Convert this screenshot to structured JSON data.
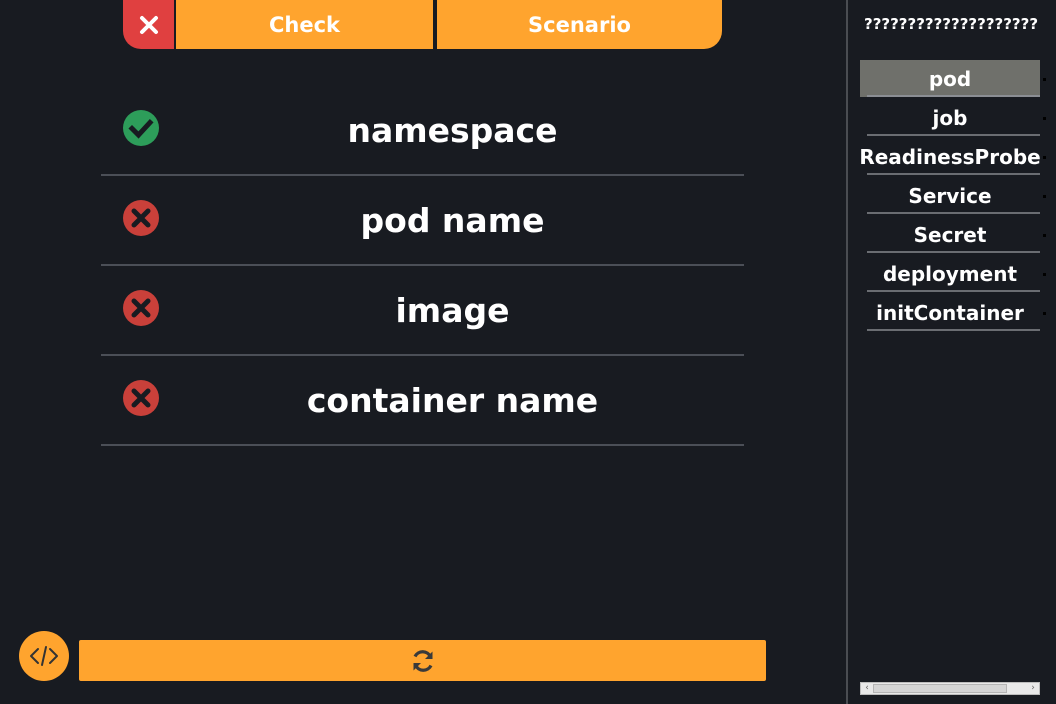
{
  "tabs": {
    "close_icon": "close-icon",
    "check_label": "Check",
    "scenario_label": "Scenario"
  },
  "checklist": [
    {
      "label": "namespace",
      "status": "pass"
    },
    {
      "label": "pod name",
      "status": "fail"
    },
    {
      "label": "image",
      "status": "fail"
    },
    {
      "label": "container name",
      "status": "fail"
    }
  ],
  "bottom": {
    "code_icon": "code-icon",
    "refresh_icon": "refresh-icon"
  },
  "sidebar": {
    "title": "????????????????????",
    "items": [
      {
        "label": "pod",
        "active": true
      },
      {
        "label": "job",
        "active": false
      },
      {
        "label": "ReadinessProbe",
        "active": false
      },
      {
        "label": "Service",
        "active": false
      },
      {
        "label": "Secret",
        "active": false
      },
      {
        "label": "deployment",
        "active": false
      },
      {
        "label": "initContainer",
        "active": false
      }
    ]
  },
  "colors": {
    "background": "#181b21",
    "accent": "#ffa42e",
    "close_red": "#e04040",
    "pass_green": "#2d9d5a",
    "fail_red": "#c9403a"
  }
}
